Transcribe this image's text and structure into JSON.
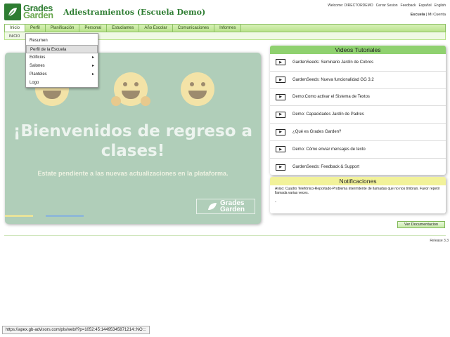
{
  "header": {
    "logo_line1": "Grades",
    "logo_line2": "Garden",
    "title": "Adiestramientos (Escuela Demo)",
    "top_links": [
      "Welcome: DIRECTORDEMO",
      "Cerrar Sesion",
      "Feedback",
      "Español",
      "English"
    ],
    "school_label": "Escuela",
    "separator": "|",
    "account_label": "Mi Cuenta"
  },
  "menu": {
    "items": [
      "Inicio",
      "Perfil",
      "Planificación",
      "Personal",
      "Estudiantes",
      "Año Escolar",
      "Comunicaciones",
      "Informes"
    ],
    "active_index": 0
  },
  "breadcrumb": "INICIO",
  "dropdown": {
    "items": [
      {
        "label": "Resumen",
        "arrow": ""
      },
      {
        "label": "Perfil de la Escuela",
        "arrow": "",
        "highlighted": true
      },
      {
        "label": "Edificios",
        "arrow": "▸"
      },
      {
        "label": "Salones",
        "arrow": "▸"
      },
      {
        "label": "Planteles",
        "arrow": "▸"
      },
      {
        "label": "Logo",
        "arrow": ""
      }
    ]
  },
  "banner": {
    "headline": "¡Bienvenidos de regreso a clases!",
    "subtext": "Estate pendiente a las nuevas actualizaciones en la plataforma.",
    "logo_line1": "Grades",
    "logo_line2": "Garden",
    "bg_color": "#b0ceb9"
  },
  "videos": {
    "title": "Videos Tutoriales",
    "items": [
      "GardenSeeds: Seminario Jardín de Cobros",
      "GardenSeeds: Nueva funcionalidad GG 3.2",
      "Demo:Como activar el Sistema de Textos",
      "Demo: Capacidades Jardín de Padres",
      "¿Qué es Grades Garden?",
      "Demo: Cómo enviar mensajes de texto",
      "GardenSeeds: Feedback & Support"
    ]
  },
  "notifications": {
    "title": "Notificaciones",
    "message": "Aviso: Cuadro Telefónico-Reportado-Problema intermitente de llamadas que no nos timbran. Favor repetir llamada varias veces.",
    "bullet": "-"
  },
  "doc_button": "Ver Documentacion",
  "release": "Release 3.3",
  "status_url": "https://apex.gb-advisors.com/pls/web/f?p=1052:45:14495345871214::NO:::",
  "colors": {
    "brand_green": "#2e7d32",
    "menu_green": "#b9e38c",
    "video_header": "#8fd16f",
    "notif_header": "#f2f29a"
  }
}
